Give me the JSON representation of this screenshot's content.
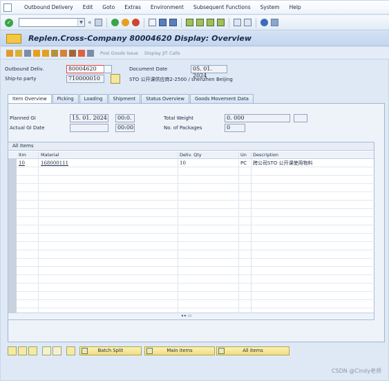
{
  "menubar": {
    "items": [
      "Outbound Delivery",
      "Edit",
      "Goto",
      "Extras",
      "Environment",
      "Subsequent Functions",
      "System",
      "Help"
    ]
  },
  "toolbar": {
    "command_value": "",
    "nav_glyph": "«",
    "icons": [
      "enter-icon",
      "save-icon",
      "back-icon",
      "exit-icon",
      "cancel-icon",
      "print-icon",
      "find-icon",
      "find-next-icon",
      "first-page-icon",
      "prev-page-icon",
      "next-page-icon",
      "last-page-icon",
      "new-session-icon",
      "shortcut-icon",
      "help-icon",
      "customize-icon"
    ]
  },
  "title": "Replen.Cross-Company 80004620 Display: Overview",
  "apptoolbar": {
    "post_goods_issue": "Post Goods Issue",
    "display_jit_calls": "Display JIT Calls"
  },
  "header": {
    "outbound_delivery_label": "Outbound Deliv.",
    "outbound_delivery_value": "80004620",
    "document_date_label": "Document Date",
    "document_date_value": "05. 01. 2024",
    "ship_to_label": "Ship-to party",
    "ship_to_value": "710000010",
    "ship_to_desc": "STO 公开课供应商2-2500 / shenzhen Beijing"
  },
  "tabs": [
    "Item Overview",
    "Picking",
    "Loading",
    "Shipment",
    "Status Overview",
    "Goods Movement Data"
  ],
  "overview": {
    "planned_gi_label": "Planned GI",
    "planned_gi_date": "15. 01. 2024",
    "planned_gi_time": "00:0.",
    "actual_gi_label": "Actual GI Date",
    "actual_gi_date": "",
    "actual_gi_time": "00:00",
    "total_weight_label": "Total Weight",
    "total_weight_value": "0. 000",
    "packages_label": "No. of Packages",
    "packages_value": "0"
  },
  "grid": {
    "title": "All Items",
    "columns": [
      "Itm",
      "Material",
      "Deliv. Qty",
      "Un",
      "Description"
    ],
    "rows": [
      {
        "itm": "10",
        "material": "168000111",
        "qty": "10",
        "un": "PC",
        "desc": "跨公司STO 公开课使用物料"
      }
    ]
  },
  "bottom": {
    "batch_split": "Batch Split",
    "main_items": "Main items",
    "all_items": "All items"
  },
  "watermark": "CSDN @Cindy老师"
}
